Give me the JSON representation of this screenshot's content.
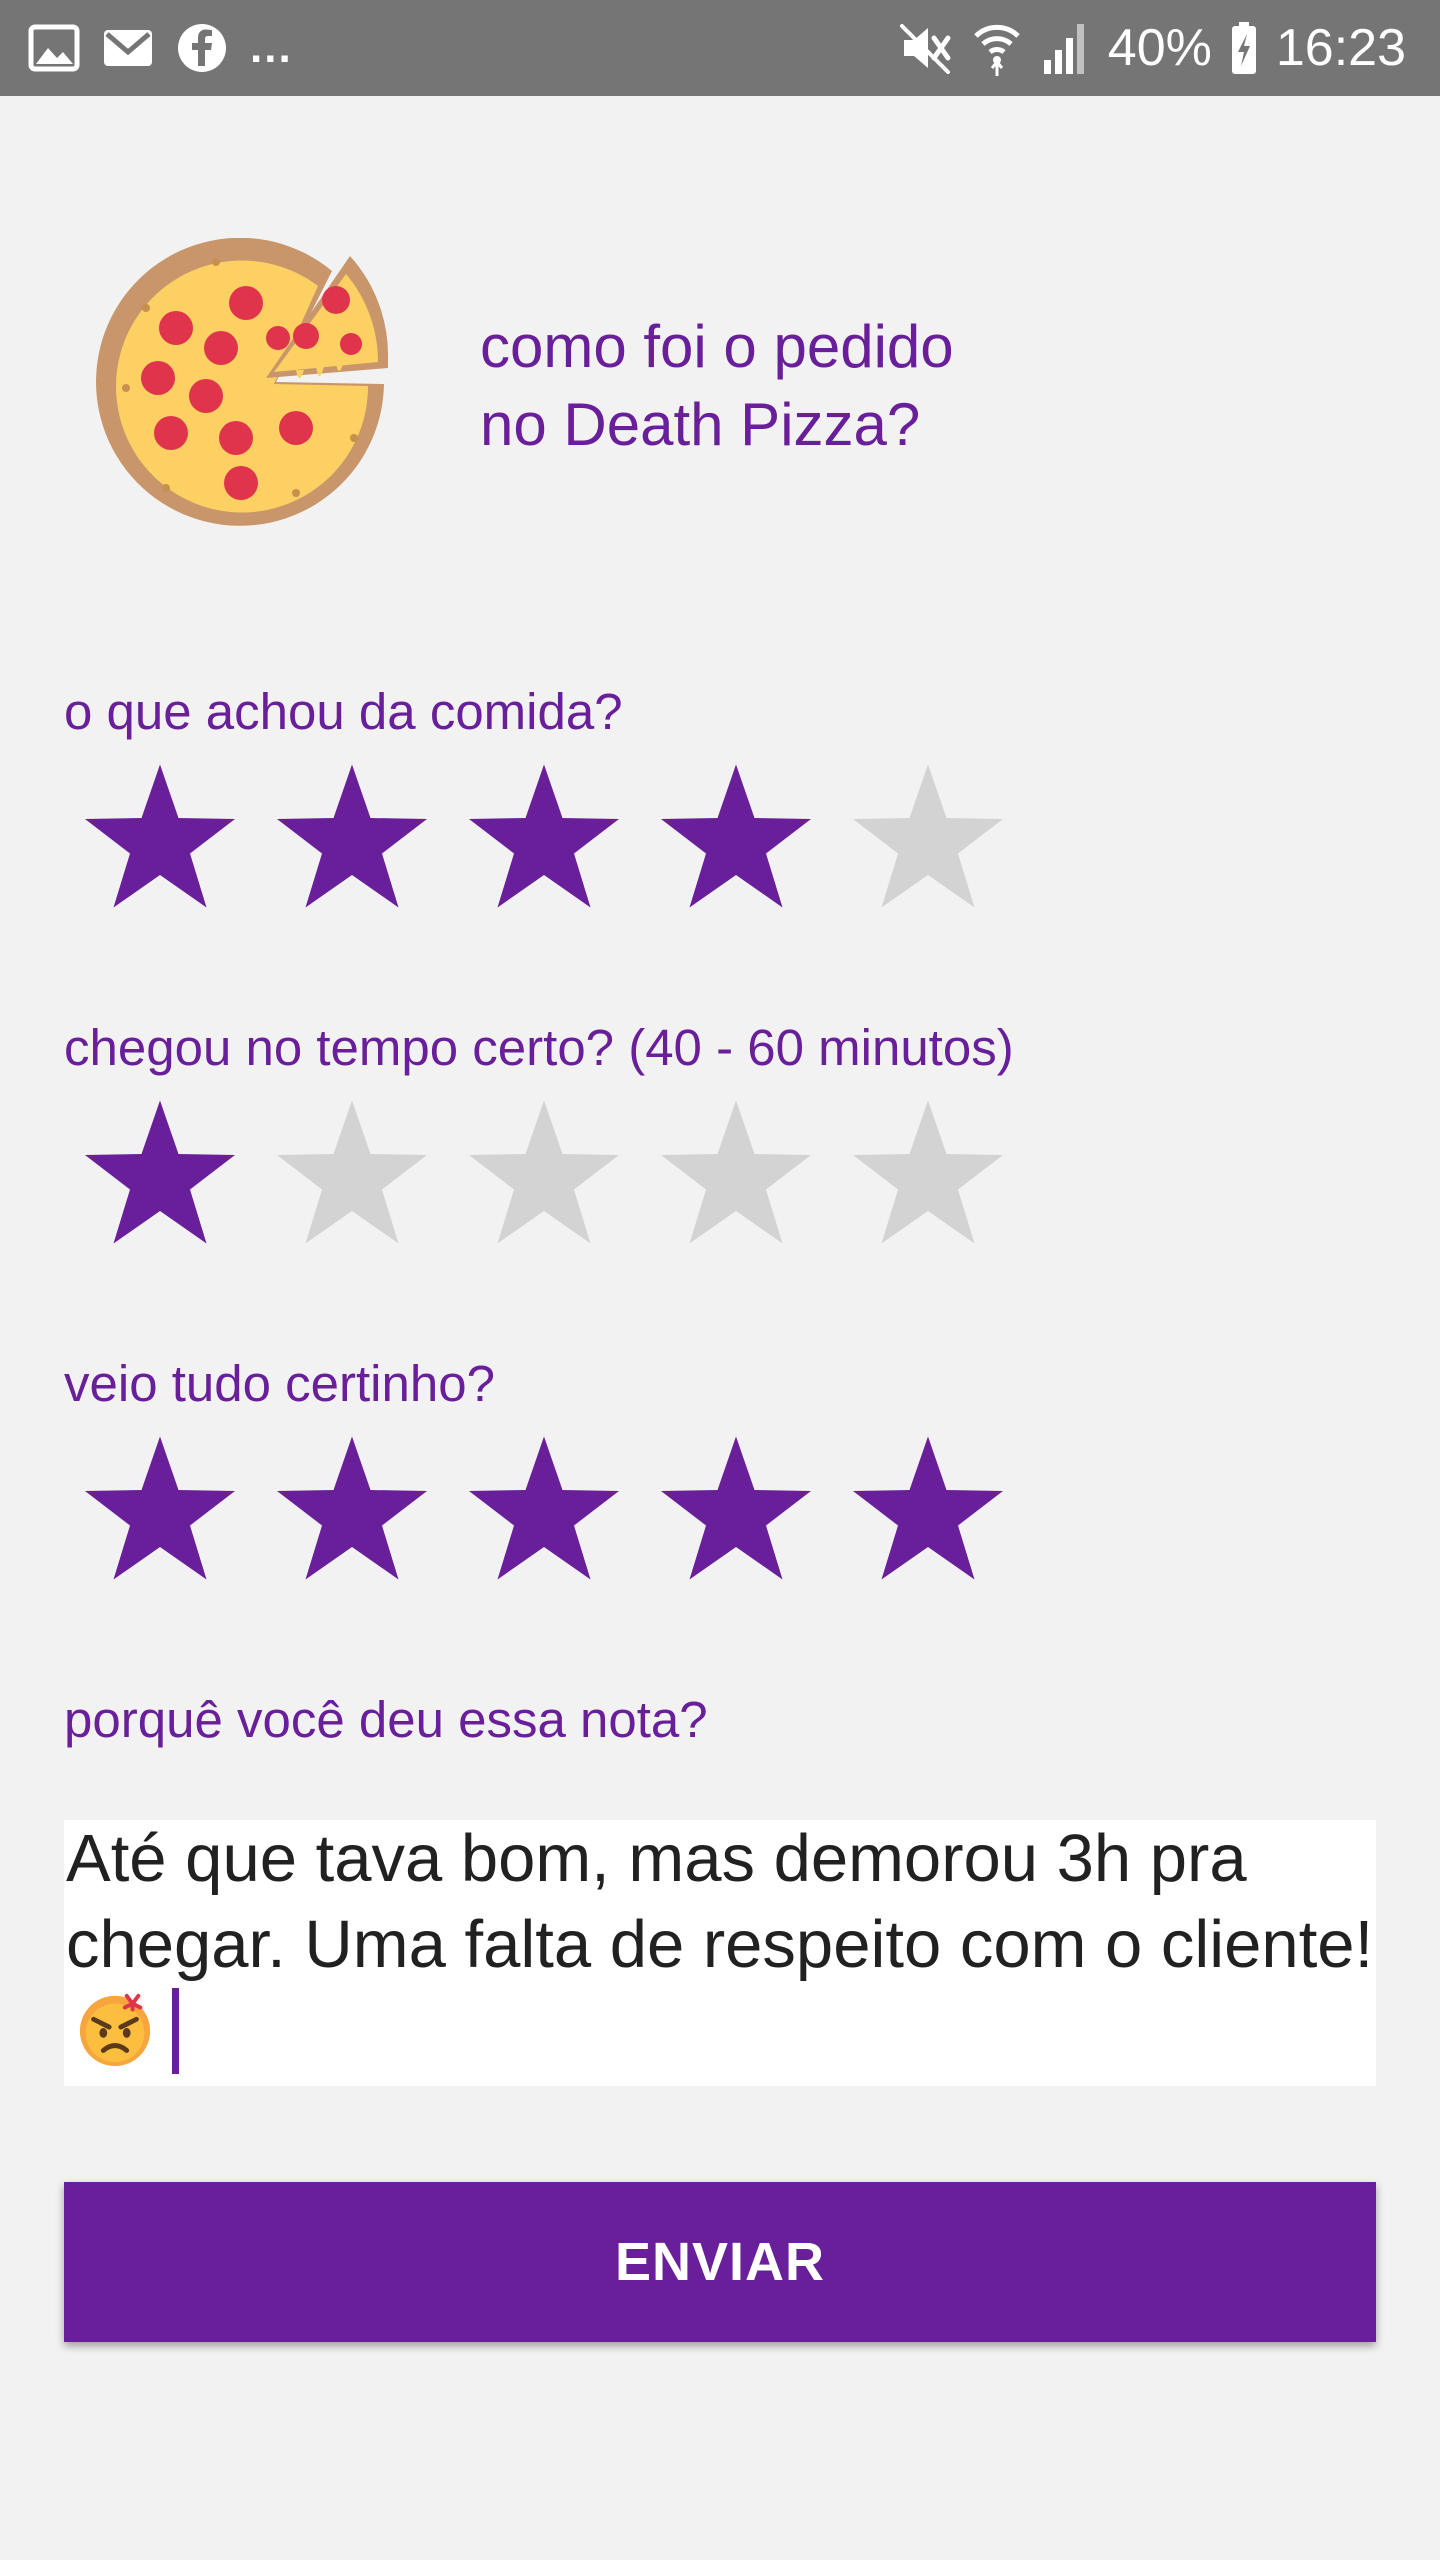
{
  "status_bar": {
    "more": "...",
    "battery": "40%",
    "time": "16:23",
    "icons": [
      "image-icon",
      "mail-icon",
      "facebook-icon",
      "mute-icon",
      "wifi-icon",
      "signal-icon",
      "battery-charging-icon"
    ]
  },
  "header": {
    "title_line1": "como foi o pedido",
    "title_line2": "no Death Pizza?",
    "icon": "pizza-icon"
  },
  "ratings": [
    {
      "question": "o que achou da comida?",
      "value": 4,
      "max": 5
    },
    {
      "question": "chegou no tempo certo? (40 - 60 minutos)",
      "value": 1,
      "max": 5
    },
    {
      "question": "veio tudo certinho?",
      "value": 5,
      "max": 5
    }
  ],
  "comment": {
    "label": "porquê você deu essa nota?",
    "value": "Até que tava bom, mas demorou 3h pra chegar. Uma falta de respeito com o cliente!",
    "emoji": "angry-face-emoji"
  },
  "submit_label": "ENVIAR",
  "colors": {
    "accent": "#6a1f9a",
    "star_empty": "#d3d3d3",
    "background": "#f2f2f2",
    "status_bar": "#757575"
  }
}
